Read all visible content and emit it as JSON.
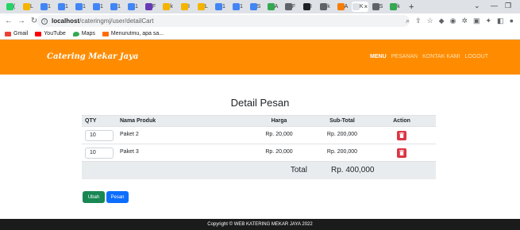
{
  "browser": {
    "tabs": [
      {
        "label": "(",
        "color": "#25d366"
      },
      {
        "label": "L",
        "color": "#f4b400"
      },
      {
        "label": "1",
        "color": "#4285f4"
      },
      {
        "label": "1",
        "color": "#4285f4"
      },
      {
        "label": "1",
        "color": "#4285f4"
      },
      {
        "label": "1",
        "color": "#4285f4"
      },
      {
        "label": "1",
        "color": "#4285f4"
      },
      {
        "label": "1",
        "color": "#4285f4"
      },
      {
        "label": "F",
        "color": "#673ab7"
      },
      {
        "label": "k",
        "color": "#f4b400"
      },
      {
        "label": "I",
        "color": "#f4b400"
      },
      {
        "label": "L",
        "color": "#f4b400"
      },
      {
        "label": "1",
        "color": "#4285f4"
      },
      {
        "label": "1",
        "color": "#4285f4"
      },
      {
        "label": "S",
        "color": "#4285f4"
      },
      {
        "label": "A",
        "color": "#34a853"
      },
      {
        "label": "F",
        "color": "#5f6368"
      },
      {
        "label": "I",
        "color": "#202124"
      },
      {
        "label": "k",
        "color": "#5f6368"
      },
      {
        "label": "A",
        "color": "#f57c00"
      },
      {
        "label": "K",
        "color": "#dee1e6"
      },
      {
        "label": "S",
        "color": "#5f6368"
      },
      {
        "label": "k",
        "color": "#34a853"
      }
    ],
    "url_host": "localhost",
    "url_path": "/cateringmj/user/detailCart",
    "bookmarks": [
      {
        "label": "Gmail",
        "color": "#ea4335"
      },
      {
        "label": "YouTube",
        "color": "#ff0000"
      },
      {
        "label": "Maps",
        "color": "#34a853"
      },
      {
        "label": "Menurutmu, apa sa...",
        "color": "#ff6d00"
      }
    ]
  },
  "site": {
    "brand": "Catering Mekar Jaya",
    "nav": [
      "MENU",
      "PESANAN",
      "KONTAK KAMI",
      "LOGOUT"
    ]
  },
  "page": {
    "title": "Detail Pesan",
    "columns": [
      "QTY",
      "Nama Produk",
      "Harga",
      "Sub-Total",
      "Action"
    ],
    "items": [
      {
        "qty": "10",
        "name": "Paket 2",
        "price": "Rp. 20,000",
        "subtotal": "Rp. 200,000"
      },
      {
        "qty": "10",
        "name": "Paket 3",
        "price": "Rp. 20,000",
        "subtotal": "Rp. 200,000"
      }
    ],
    "total_label": "Total",
    "total_value": "Rp. 400,000",
    "buttons": {
      "update": "Ubah",
      "order": "Pesan"
    },
    "footer": "Copyright © WEB KATERING MEKAR JAYA 2022"
  },
  "colors": {
    "navbar": "#ff8c00",
    "delete": "#dc3545",
    "update": "#198754",
    "order": "#0d6efd",
    "footer": "#1b1b1b"
  }
}
